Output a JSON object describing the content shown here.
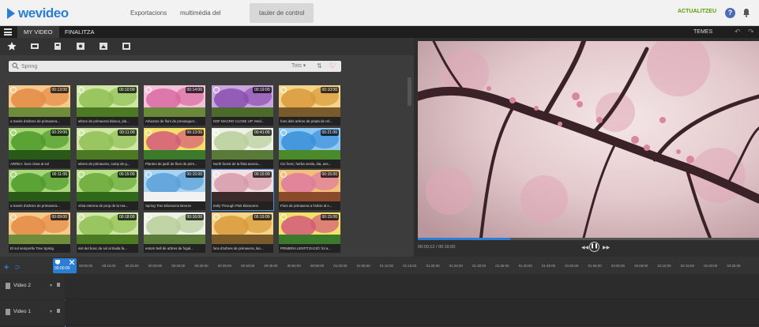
{
  "header": {
    "brand": "wevideo",
    "nav": [
      "Exportacions",
      "multimèdia del",
      "tauler de control"
    ],
    "update_label": "ACTUALITZEU",
    "help_label": "?"
  },
  "subbar": {
    "tabs": [
      "MY VIDEO",
      "FINALITZA"
    ],
    "themes_label": "TEMES"
  },
  "library": {
    "search_placeholder": "Spring",
    "filter_label": "Tots ▾",
    "items": [
      {
        "caption": "a través d'arbres de primavera...",
        "duration": "00:13:00",
        "palette": "sunset"
      },
      {
        "caption": "arbres de primavera blanca, pla...",
        "duration": "00:10:00",
        "palette": "meadow"
      },
      {
        "caption": "Arbustos de flors de presseguer...",
        "duration": "00:14:00",
        "palette": "pink"
      },
      {
        "caption": "DOF MACRO CLOSE UP: Mod...",
        "duration": "00:19:00",
        "palette": "purple"
      },
      {
        "caption": "fons dels arbres de prada de rel...",
        "duration": "00:10:00",
        "palette": "golden"
      },
      {
        "caption": "ARREA: bosc clara al sol",
        "duration": "00:29:00",
        "palette": "forest"
      },
      {
        "caption": "arbres de primavera, camp de g...",
        "duration": "00:11:00",
        "palette": "meadow"
      },
      {
        "caption": "Plantes de jardí de flors de prim...",
        "duration": "00:13:00",
        "palette": "flowers"
      },
      {
        "caption": "North forest de la flota aixeca...",
        "duration": "00:41:00",
        "palette": "whiteflowers"
      },
      {
        "caption": "Cis fresc, herba verda, dia, ass...",
        "duration": "00:21:00",
        "palette": "sky"
      },
      {
        "caption": "a través d'arbres de primavera...",
        "duration": "00:11:00",
        "palette": "forest"
      },
      {
        "caption": "Vista estrena de prop de la rea...",
        "duration": "00:15:00",
        "palette": "grass"
      },
      {
        "caption": "Spring Tree Blossoms Breeze",
        "duration": "00:15:00",
        "palette": "bluesky"
      },
      {
        "caption": "Dolly Through Pink Blossoms",
        "duration": "00:15:00",
        "palette": "blossom"
      },
      {
        "caption": "Flors de primavera a l'arbre al s...",
        "duration": "00:15:00",
        "palette": "sunpink"
      },
      {
        "caption": "El sol semprefix Tree Spring",
        "duration": "00:09:00",
        "palette": "sunset"
      },
      {
        "caption": "lent del bosc de sol al Iluida fa...",
        "duration": "00:18:00",
        "palette": "meadow"
      },
      {
        "caption": "entorn bell de arbres de fogal...",
        "duration": "00:16:00",
        "palette": "whiteflowers"
      },
      {
        "caption": "fons d'arbres de primavera, lan...",
        "duration": "00:19:00",
        "palette": "golden"
      },
      {
        "caption": "PRIMERA LENTITZACIÓ: fol a...",
        "duration": "00:15:00",
        "palette": "flowers"
      }
    ]
  },
  "preview": {
    "timecode": "00:00:12 / 00:16:00",
    "progress": 0.27
  },
  "timeline": {
    "playhead_time": "00:00:00",
    "ticks": [
      "00:05:00",
      "00:10:00",
      "00:15:00",
      "00:20:00",
      "00:25:00",
      "00:30:00",
      "00:35:00",
      "00:40:00",
      "00:45:00",
      "00:50:00",
      "00:55:00",
      "01:00:00",
      "01:05:00",
      "01:10:00",
      "01:15:00",
      "01:20:00",
      "01:25:00",
      "01:30:00",
      "01:35:00",
      "01:40:00",
      "01:45:00",
      "01:50:00",
      "01:55:00",
      "02:00:00",
      "02:05:00",
      "02:10:00",
      "02:15:00",
      "02:20:00",
      "02:25:00"
    ],
    "tracks": [
      "Video 2",
      "Video 1"
    ]
  },
  "colors": {
    "accent": "#2a7fd4",
    "update": "#5aa000"
  }
}
